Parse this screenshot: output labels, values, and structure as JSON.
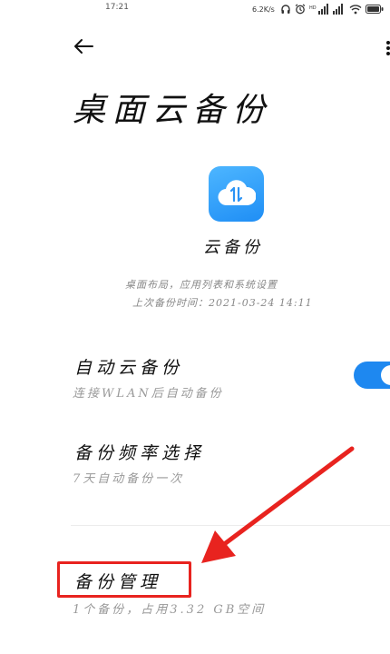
{
  "status_bar": {
    "time": "17:21",
    "net_speed": "6.2K/s"
  },
  "header": {
    "back_icon": "arrow-left-icon",
    "more_icon": "more-vertical-icon",
    "title": "桌面云备份"
  },
  "app": {
    "icon": "cloud-sync-icon",
    "name": "云备份",
    "description": "桌面布局，应用列表和系统设置",
    "last_backup": "上次备份时间：2021-03-24 14:11"
  },
  "settings": [
    {
      "title": "自动云备份",
      "subtitle": "连接WLAN后自动备份",
      "toggle_on": true
    },
    {
      "title": "备份频率选择",
      "subtitle": "7天自动备份一次"
    },
    {
      "title": "备份管理",
      "subtitle": "1个备份，占用3.32 GB空间"
    }
  ],
  "annotation": {
    "color": "#e8231f"
  },
  "colors": {
    "accent": "#1e88f0"
  }
}
